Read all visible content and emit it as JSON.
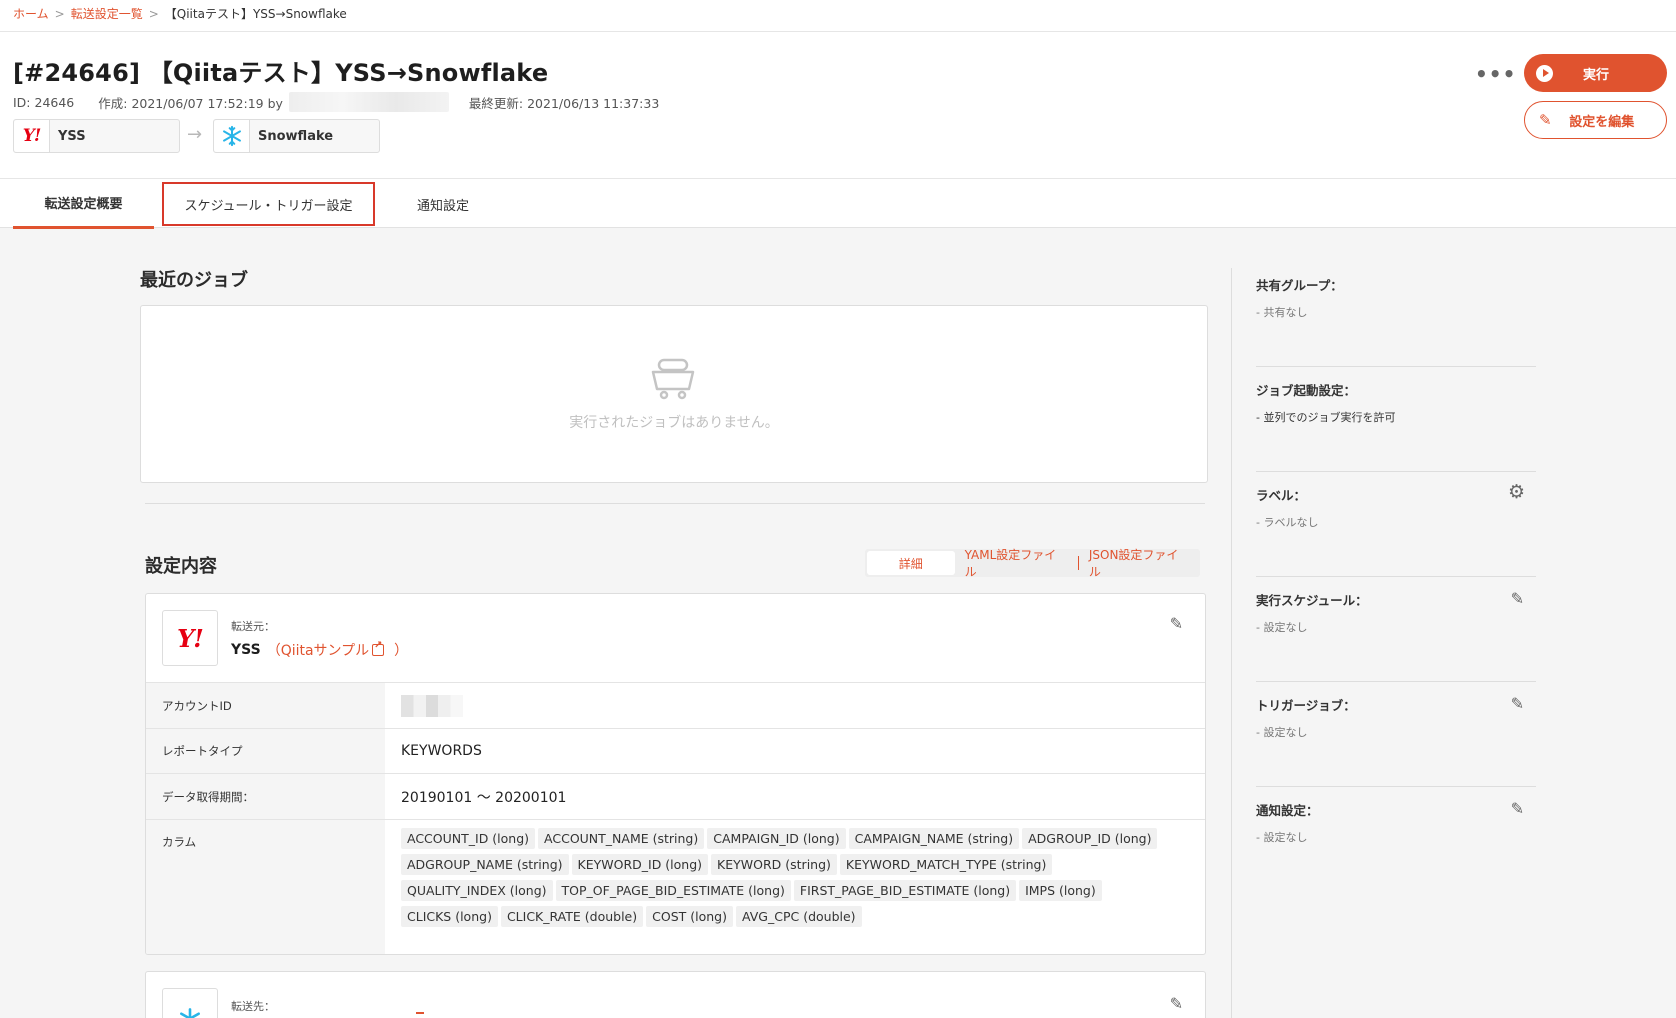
{
  "breadcrumb": {
    "home": "ホーム",
    "list": "転送設定一覧",
    "current": "【Qiitaテスト】YSS→Snowflake",
    "sep": ">"
  },
  "header": {
    "title": "[#24646] 【Qiitaテスト】YSS→Snowflake",
    "id_text": "ID: 24646",
    "created_text": "作成: 2021/06/07 17:52:19 by",
    "updated_text": "最終更新: 2021/06/13 11:37:33",
    "source_name": "YSS",
    "dest_name": "Snowflake",
    "source_logo_text": "Y!",
    "arrow": "→",
    "more": "•••",
    "run_label": "実行",
    "edit_label": "設定を編集"
  },
  "tabs": [
    {
      "label": "転送設定概要",
      "active": true
    },
    {
      "label": "スケジュール・トリガー設定",
      "active": false
    },
    {
      "label": "通知設定",
      "active": false
    }
  ],
  "jobs": {
    "title": "最近のジョブ",
    "empty_text": "実行されたジョブはありません。"
  },
  "settings": {
    "title": "設定内容",
    "view_options": [
      "詳細",
      "YAML設定ファイル",
      "JSON設定ファイル"
    ],
    "source_card": {
      "sublabel": "転送元：",
      "name": "YSS",
      "open_paren": "（",
      "link_text": "Qiitaサンプル",
      "close_paren": "）",
      "logo_text": "Y!",
      "rows": [
        {
          "key": "アカウントID",
          "value": ""
        },
        {
          "key": "レポートタイプ",
          "value": "KEYWORDS"
        },
        {
          "key": "データ取得期間：",
          "value": "20190101 〜 20200101"
        },
        {
          "key": "カラム",
          "value": ""
        }
      ],
      "columns": [
        "ACCOUNT_ID (long)",
        "ACCOUNT_NAME (string)",
        "CAMPAIGN_ID (long)",
        "CAMPAIGN_NAME (string)",
        "ADGROUP_ID (long)",
        "ADGROUP_NAME (string)",
        "KEYWORD_ID (long)",
        "KEYWORD (string)",
        "KEYWORD_MATCH_TYPE (string)",
        "QUALITY_INDEX (long)",
        "TOP_OF_PAGE_BID_ESTIMATE (long)",
        "FIRST_PAGE_BID_ESTIMATE (long)",
        "IMPS (long)",
        "CLICKS (long)",
        "CLICK_RATE (double)",
        "COST (long)",
        "AVG_CPC (double)"
      ]
    },
    "dest_card": {
      "sublabel": "転送先："
    }
  },
  "sidebar": [
    {
      "title": "共有グループ：",
      "desc": "- 共有なし",
      "action": null
    },
    {
      "title": "ジョブ起動設定：",
      "desc": "- 並列でのジョブ実行を許可",
      "action": null
    },
    {
      "title": "ラベル：",
      "desc": "- ラベルなし",
      "action": "gear-icon"
    },
    {
      "title": "実行スケジュール：",
      "desc": "- 設定なし",
      "action": "pencil-icon"
    },
    {
      "title": "トリガージョブ：",
      "desc": "- 設定なし",
      "action": "pencil-icon"
    },
    {
      "title": "通知設定：",
      "desc": "- 設定なし",
      "action": "pencil-icon"
    }
  ],
  "colors": {
    "accent": "#e0532f",
    "highlight_box": "#d8392a",
    "yahoo_red": "#e60012",
    "snowflake_blue": "#29b5e8"
  }
}
